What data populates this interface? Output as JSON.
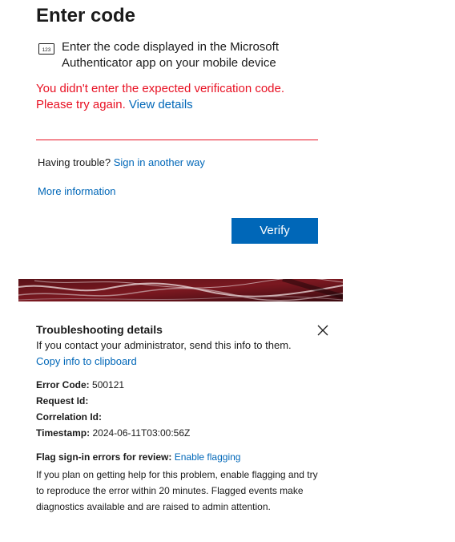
{
  "header": {
    "title": "Enter code"
  },
  "instructions": {
    "icon": "keypad-123-icon",
    "text": "Enter the code displayed in the Microsoft Authenticator app on your mobile device"
  },
  "error": {
    "message": "You didn't enter the expected verification code. Please try again.",
    "link_label": "View details",
    "color": "#e81123"
  },
  "code_input": {
    "value": "",
    "placeholder": ""
  },
  "help": {
    "trouble_prefix": "Having trouble?",
    "trouble_link": "Sign in another way",
    "more_info": "More information"
  },
  "actions": {
    "verify_label": "Verify",
    "accent": "#0067b8"
  },
  "troubleshooting": {
    "title": "Troubleshooting details",
    "subtitle": "If you contact your administrator, send this info to them.",
    "copy_link": "Copy info to clipboard",
    "close_icon": "close-icon",
    "error_code_label": "Error Code:",
    "error_code_value": "500121",
    "request_id_label": "Request Id:",
    "request_id_value": "",
    "correlation_id_label": "Correlation Id:",
    "correlation_id_value": "",
    "timestamp_label": "Timestamp:",
    "timestamp_value": "2024-06-11T03:00:56Z",
    "flag_label": "Flag sign-in errors for review:",
    "flag_link": "Enable flagging",
    "flag_description": "If you plan on getting help for this problem, enable flagging and try to reproduce the error within 20 minutes. Flagged events make diagnostics available and are raised to admin attention."
  }
}
